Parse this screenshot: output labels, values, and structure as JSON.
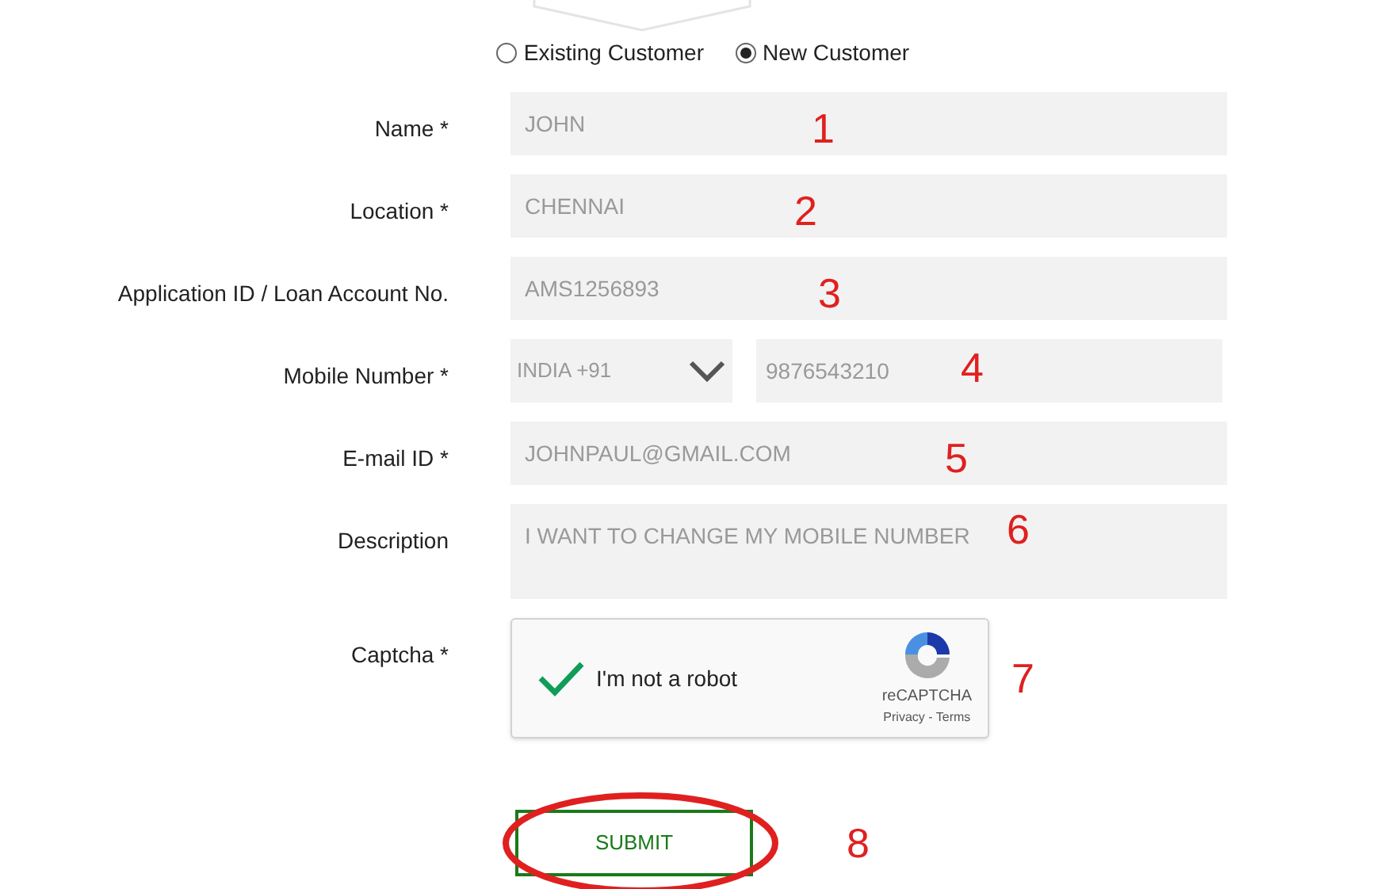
{
  "customer_type": [
    {
      "label": "Existing Customer",
      "selected": false
    },
    {
      "label": "New Customer",
      "selected": true
    }
  ],
  "fields": [
    {
      "kind": "text",
      "label": "Name *",
      "value": "JOHN",
      "marker": "1"
    },
    {
      "kind": "text",
      "label": "Location *",
      "value": "CHENNAI",
      "marker": "2"
    },
    {
      "kind": "text",
      "label": "Application ID / Loan Account No.",
      "value": "AMS1256893",
      "marker": "3"
    },
    {
      "kind": "phone",
      "label": "Mobile Number *",
      "country": "INDIA +91",
      "value": "9876543210",
      "marker": "4"
    },
    {
      "kind": "text",
      "label": "E-mail ID *",
      "value": "JOHNPAUL@GMAIL.COM",
      "marker": "5"
    },
    {
      "kind": "textarea",
      "label": "Description",
      "value": "I WANT TO CHANGE MY MOBILE NUMBER",
      "marker": "6"
    },
    {
      "kind": "captcha",
      "label": "Captcha *",
      "checked": true,
      "text": "I'm not a robot",
      "brand": "reCAPTCHA",
      "links": "Privacy - Terms",
      "marker": "7"
    }
  ],
  "submit": {
    "label": "SUBMIT",
    "marker": "8"
  }
}
